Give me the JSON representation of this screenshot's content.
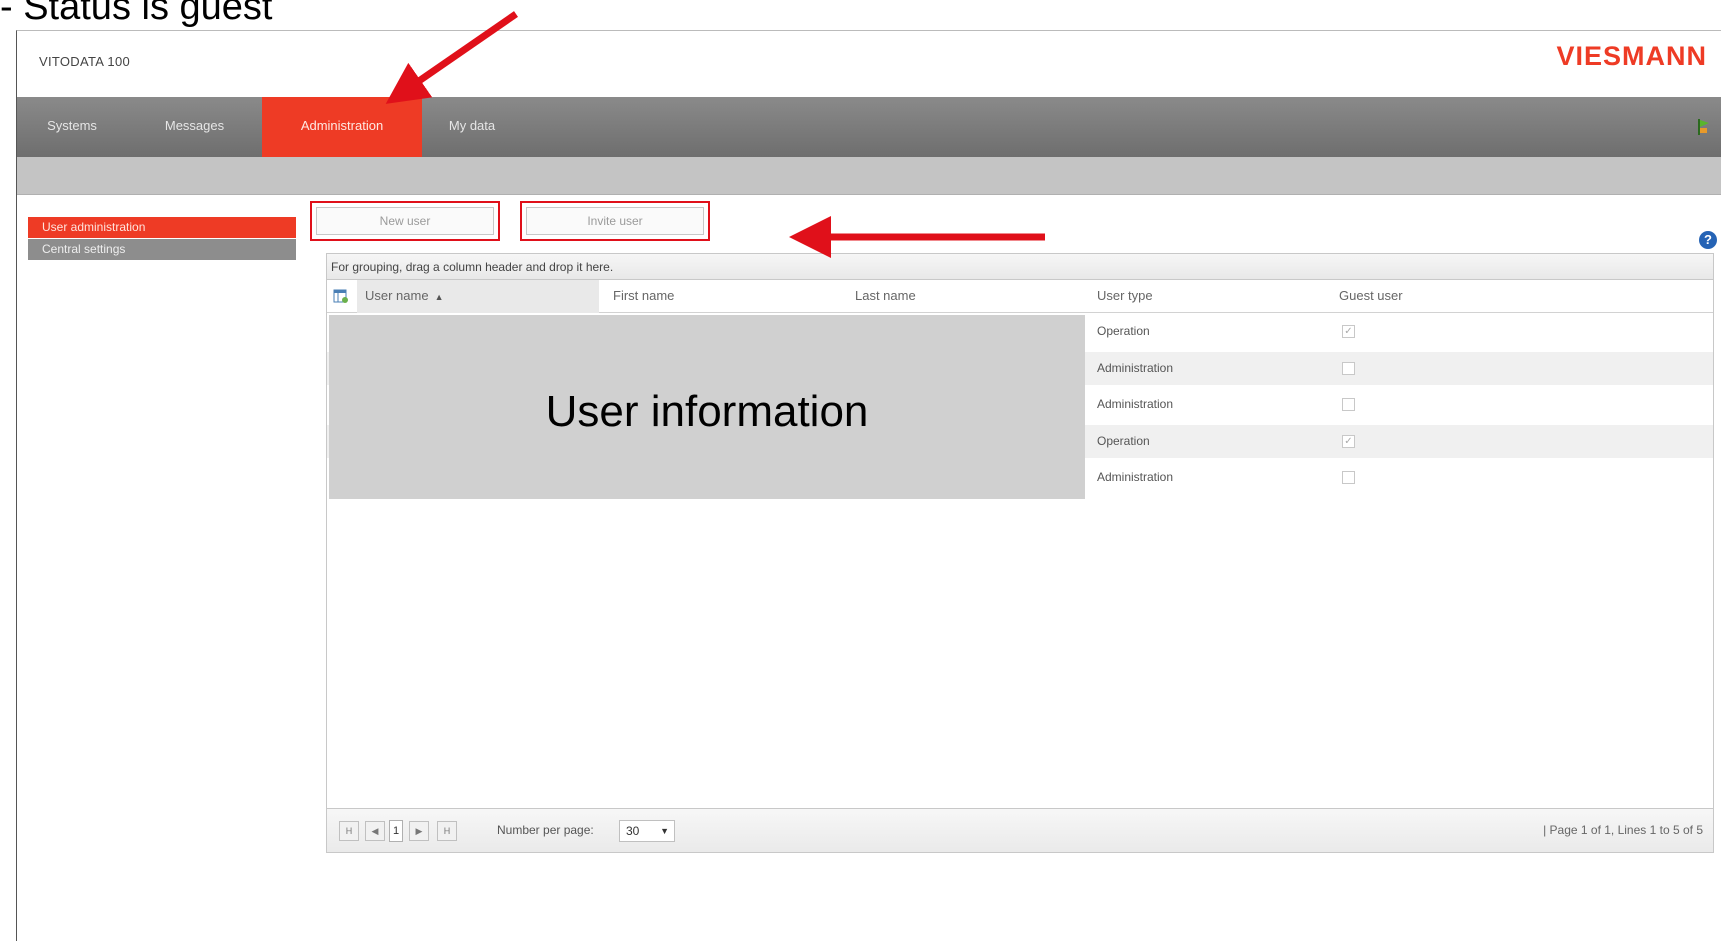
{
  "caption": "- Status is guest",
  "app": {
    "title": "VITODATA 100",
    "logo": "VIESMANN"
  },
  "nav": {
    "items": [
      {
        "label": "Systems"
      },
      {
        "label": "Messages"
      },
      {
        "label": "Administration",
        "active": true
      },
      {
        "label": "My data"
      }
    ],
    "flag_icon": "flag-icon"
  },
  "sidebar": {
    "items": [
      {
        "label": "User administration",
        "active": true
      },
      {
        "label": "Central settings"
      }
    ]
  },
  "toolbar": {
    "new_user": "New user",
    "invite_user": "Invite user",
    "help": "?"
  },
  "grid": {
    "group_hint": "For grouping, drag a column header and drop it here.",
    "columns": [
      "User name",
      "First name",
      "Last name",
      "User type",
      "Guest user"
    ],
    "sort_indicator": "▲",
    "rows": [
      {
        "user_type": "Operation",
        "guest": true
      },
      {
        "user_type": "Administration",
        "guest": false
      },
      {
        "user_type": "Administration",
        "guest": false
      },
      {
        "user_type": "Operation",
        "guest": true
      },
      {
        "user_type": "Administration",
        "guest": false
      }
    ],
    "overlay_text": "User information"
  },
  "pager": {
    "first": "H",
    "prev": "◀",
    "current": "1",
    "next": "▶",
    "last": "H",
    "per_page_label": "Number per page:",
    "per_page_value": "30",
    "info": "| Page 1 of 1, Lines 1 to 5 of 5"
  },
  "colors": {
    "accent": "#ee3b25",
    "nav": "#7b7b7b",
    "annotation": "#e0101a"
  }
}
